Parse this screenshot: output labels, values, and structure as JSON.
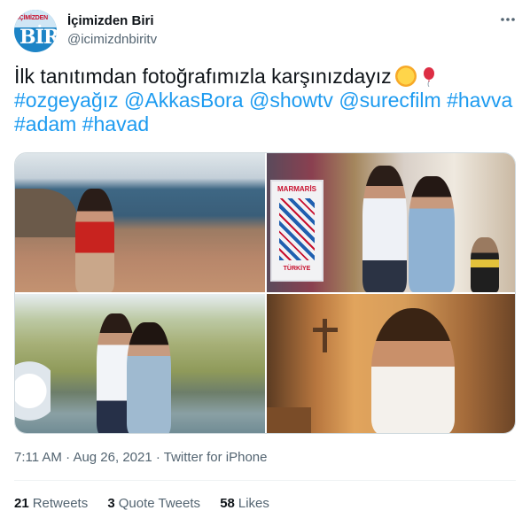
{
  "author": {
    "name": "İçimizden Biri",
    "handle": "@icimizdnbiritv",
    "avatar_text_top": "İÇİMİZDEN",
    "avatar_text_bottom": "BİR"
  },
  "tweet": {
    "line1": "İlk tanıtımdan fotoğrafımızla karşınızdayız",
    "emoji": [
      "sun-emoji",
      "balloon-emoji"
    ],
    "tags_line2": [
      "#ozgeyağız",
      "@AkkasBora",
      "@showtv",
      "@surecfilm",
      "#havva"
    ],
    "tags_line3": [
      "#adam",
      "#havad"
    ]
  },
  "media": {
    "photos": [
      "photo-coast-woman",
      "photo-market-couple",
      "photo-lake-couple",
      "photo-church-man"
    ],
    "sign_text_1": "MARMARİS",
    "sign_text_2": "TÜRKİYE"
  },
  "meta": {
    "time": "7:11 AM",
    "sep1": "·",
    "date": "Aug 26, 2021",
    "sep2": "·",
    "source": "Twitter for iPhone"
  },
  "stats": {
    "retweets_count": "21",
    "retweets_label": "Retweets",
    "quotes_count": "3",
    "quotes_label": "Quote Tweets",
    "likes_count": "58",
    "likes_label": "Likes"
  },
  "colors": {
    "link": "#1d9bf0",
    "text": "#0f1419",
    "secondary": "#536471"
  }
}
